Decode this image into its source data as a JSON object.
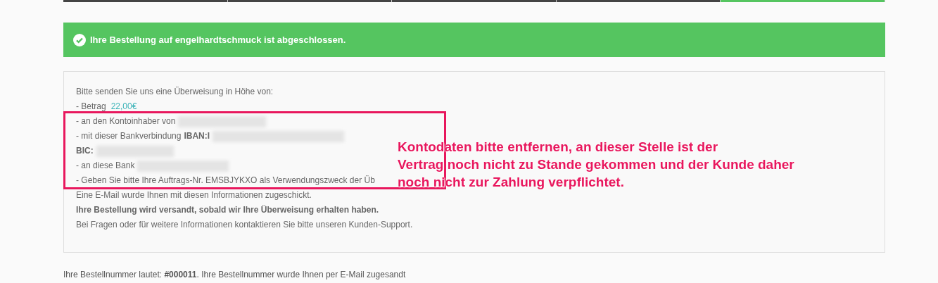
{
  "progress_steps": [
    {
      "selected": false
    },
    {
      "selected": false
    },
    {
      "selected": false
    },
    {
      "selected": false
    },
    {
      "selected": true
    }
  ],
  "alert": {
    "text": "Ihre Bestellung auf engelhardtschmuck ist abgeschlossen."
  },
  "payment_box": {
    "lines": [
      [
        {
          "kind": "text",
          "text": "Bitte senden Sie uns eine Überweisung in Höhe von:"
        }
      ],
      [
        {
          "kind": "text",
          "text": "- Betrag"
        },
        {
          "kind": "amount",
          "text": "22,00€"
        }
      ],
      [
        {
          "kind": "text",
          "text": "- an den Kontoinhaber von"
        },
        {
          "kind": "redacted"
        }
      ],
      [
        {
          "kind": "text",
          "text": "- mit dieser Bankverbindung"
        },
        {
          "kind": "bold",
          "text": "IBAN:I"
        },
        {
          "kind": "redacted"
        }
      ],
      [
        {
          "kind": "bold",
          "text": "BIC:"
        },
        {
          "kind": "redacted"
        }
      ],
      [
        {
          "kind": "text",
          "text": "- an diese Bank"
        },
        {
          "kind": "redacted"
        }
      ],
      [
        {
          "kind": "text",
          "text": "- Geben Sie bitte Ihre Auftrags-Nr. EMSBJYKXO als Verwendungszweck der Üb"
        }
      ],
      [
        {
          "kind": "text",
          "text": "Eine E-Mail wurde Ihnen mit diesen Informationen zugeschickt."
        }
      ],
      [
        {
          "kind": "bold",
          "text": "Ihre Bestellung wird versandt, sobald wir Ihre Überweisung erhalten haben."
        }
      ],
      [
        {
          "kind": "text",
          "text": "Bei Fragen oder für weitere Informationen kontaktieren Sie bitte unseren Kunden-Support."
        }
      ]
    ]
  },
  "order_number": "Ihre Bestellnummer lautet: **#000011**. Ihre Bestellnummer wurde Ihnen per E-Mail zugesandt",
  "annotation": {
    "lines": [
      "Kontodaten bitte entfernen, an dieser Stelle ist der",
      "Vertrag noch nicht zu Stande gekommen und der Kunde daher",
      "noch nicht zur Zahlung verpflichtet."
    ]
  }
}
